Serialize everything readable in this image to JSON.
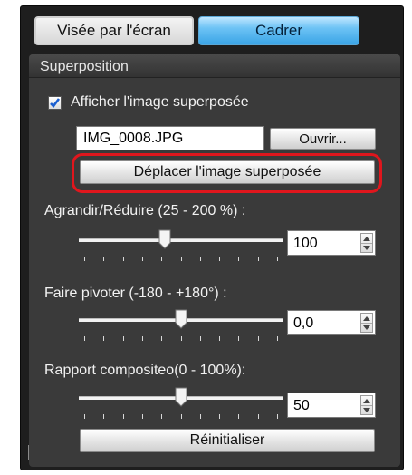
{
  "tabs": {
    "live_view": "Visée par l'écran",
    "frame": "Cadrer"
  },
  "panel": {
    "title": "Superposition",
    "show_overlay_label": "Afficher l'image superposée",
    "show_overlay_checked": true,
    "file_name": "IMG_0008.JPG",
    "open_button": "Ouvrir...",
    "move_overlay_button": "Déplacer l'image superposée"
  },
  "zoom": {
    "label": "Agrandir/Réduire (25 - 200 %) :",
    "value": "100",
    "position_fraction": 0.42
  },
  "rotate": {
    "label": "Faire pivoter (-180 - +180°) :",
    "value": "0,0",
    "position_fraction": 0.5
  },
  "opacity": {
    "label": "Rapport compositeo(0 - 100%):",
    "value": "50",
    "position_fraction": 0.5
  },
  "reset_button": "Réinitialiser",
  "colors": {
    "accent_tab": "#3aa4e6",
    "highlight": "#e0161d",
    "panel_bg": "#3a3a3a"
  }
}
